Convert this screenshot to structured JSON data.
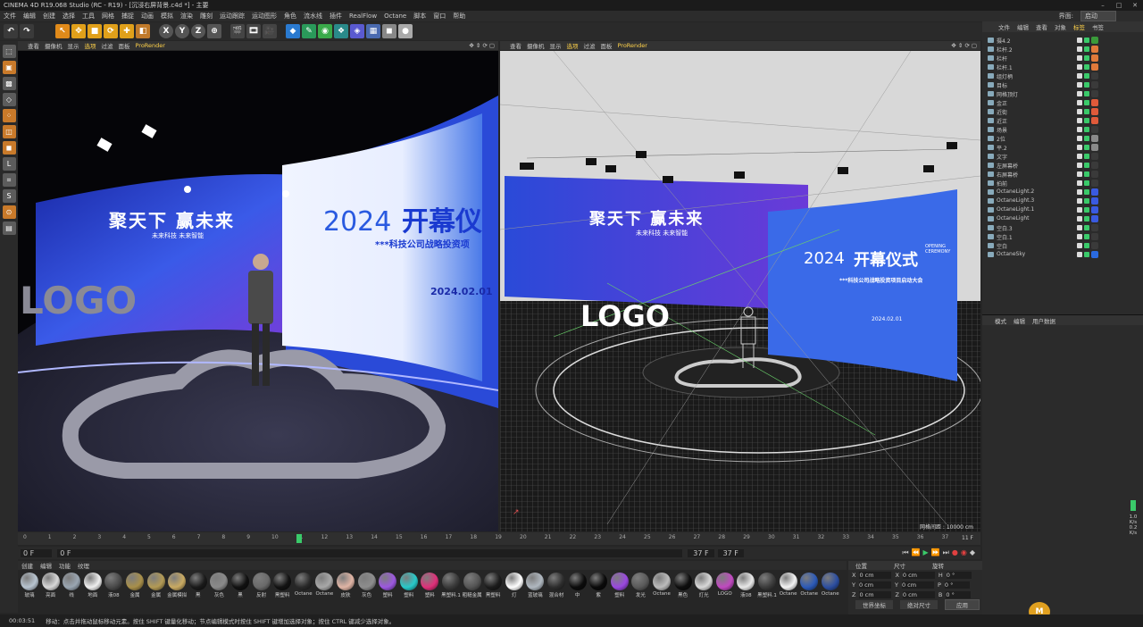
{
  "app": {
    "title": "CINEMA 4D R19.068 Studio (RC - R19) - [沉浸右屏背景.c4d *] - 主要",
    "menus": [
      "文件",
      "编辑",
      "创建",
      "选择",
      "工具",
      "网格",
      "捕捉",
      "动画",
      "模拟",
      "渲染",
      "雕刻",
      "运动跟踪",
      "运动图形",
      "角色",
      "流水线",
      "插件",
      "RealFlow",
      "Octane",
      "脚本",
      "窗口",
      "帮助"
    ],
    "layout_label": "界面:",
    "layout_value": "启动"
  },
  "toolbar": {
    "axis_x": "X",
    "axis_y": "Y",
    "axis_z": "Z"
  },
  "viewport_menu": [
    "查看",
    "摄像机",
    "显示",
    "选项",
    "过滤",
    "面板",
    "ProRender"
  ],
  "viewport_left": {
    "title_line": "聚天下 赢未来",
    "subtitle_line": "未来科技 未来智能",
    "logo": "LOGO",
    "year": "2024",
    "main_title": "开幕仪",
    "company": "***科技公司战略投资项",
    "date": "2024.02.01"
  },
  "viewport_right": {
    "title_line": "聚天下 赢未来",
    "subtitle_line": "未来科技 未来智能",
    "logo": "LOGO",
    "year": "2024",
    "main_title": "开幕仪式",
    "side_text": "OPENING CEREMONY",
    "company": "***科技公司战略投资项目启动大会",
    "date": "2024.02.01",
    "grid_label": "网格间距 : 10000 cm"
  },
  "timeline": {
    "ticks": [
      "0",
      "1",
      "2",
      "3",
      "4",
      "5",
      "6",
      "7",
      "8",
      "9",
      "10",
      "11",
      "12",
      "13",
      "14",
      "15",
      "16",
      "17",
      "18",
      "19",
      "20",
      "21",
      "22",
      "23",
      "24",
      "25",
      "26",
      "27",
      "28",
      "29",
      "30",
      "31",
      "32",
      "33",
      "34",
      "35",
      "36",
      "37"
    ],
    "current_frame": "11",
    "end_frame": "11 F"
  },
  "transport": {
    "start": "0 F",
    "field": "0 F",
    "end": "37 F",
    "end2": "37 F"
  },
  "materials_menu": [
    "创建",
    "编辑",
    "功能",
    "纹理"
  ],
  "materials": [
    {
      "name": "玻璃",
      "color": "#b8c4d0"
    },
    {
      "name": "亮面",
      "color": "#d8d8d8"
    },
    {
      "name": "线",
      "color": "#9aa6b2"
    },
    {
      "name": "地面",
      "color": "#f0f0f0"
    },
    {
      "name": "液08",
      "color": "#4a4a4a"
    },
    {
      "name": "金属",
      "color": "#a88f4a"
    },
    {
      "name": "金属",
      "color": "#b39a55"
    },
    {
      "name": "金属模拟",
      "color": "#c9aa62"
    },
    {
      "name": "黑",
      "color": "#1a1a1a"
    },
    {
      "name": "灰色",
      "color": "#8a8a8a"
    },
    {
      "name": "黑",
      "color": "#111111"
    },
    {
      "name": "反射",
      "color": "#6a6a6a"
    },
    {
      "name": "黑塑料",
      "color": "#121212"
    },
    {
      "name": "Octane",
      "color": "#2a2a2a"
    },
    {
      "name": "Octane",
      "color": "#a8a8a8"
    },
    {
      "name": "皮肤",
      "color": "#e0b5a5"
    },
    {
      "name": "灰色",
      "color": "#8d8d8d"
    },
    {
      "name": "塑料",
      "color": "#9c58e0"
    },
    {
      "name": "塑料",
      "color": "#28c9c9"
    },
    {
      "name": "塑料",
      "color": "#e0307a"
    },
    {
      "name": "黑塑料.1",
      "color": "#3a3a3a"
    },
    {
      "name": "粗糙金属",
      "color": "#555555"
    },
    {
      "name": "黑塑料",
      "color": "#1c1c1c"
    },
    {
      "name": "灯",
      "color": "#ffffff"
    },
    {
      "name": "蓝玻璃",
      "color": "#b0b8c0"
    },
    {
      "name": "混合材",
      "color": "#2e2e2e"
    },
    {
      "name": "中",
      "color": "#0c0c0c"
    },
    {
      "name": "紫",
      "color": "#0a0a0a"
    },
    {
      "name": "塑料",
      "color": "#9a48e0"
    },
    {
      "name": "发光",
      "color": "#5a5a5a"
    },
    {
      "name": "Octane",
      "color": "#bcbcbc"
    },
    {
      "name": "黑色",
      "color": "#0e0e0e"
    },
    {
      "name": "灯光",
      "color": "#d8d8d8"
    },
    {
      "name": "LOGO",
      "color": "#c04ac0"
    },
    {
      "name": "液08",
      "color": "#e8e8e8"
    },
    {
      "name": "黑塑料.1",
      "color": "#3c3c3c"
    },
    {
      "name": "Octane",
      "color": "#f4f4f4"
    },
    {
      "name": "Octane",
      "color": "#2c5ab8"
    },
    {
      "name": "Octane",
      "color": "#2c4ea0"
    }
  ],
  "coords": {
    "header": [
      "位置",
      "尺寸",
      "旋转"
    ],
    "rows": [
      {
        "a": "X",
        "av": "0 cm",
        "b": "X",
        "bv": "0 cm",
        "c": "H",
        "cv": "0 °"
      },
      {
        "a": "Y",
        "av": "0 cm",
        "b": "Y",
        "bv": "0 cm",
        "c": "P",
        "cv": "0 °"
      },
      {
        "a": "Z",
        "av": "0 cm",
        "b": "Z",
        "bv": "0 cm",
        "c": "B",
        "cv": "0 °"
      }
    ],
    "mode": "世界坐标",
    "scale_mode": "绝对尺寸",
    "apply": "应用"
  },
  "object_tabs": [
    "文件",
    "编辑",
    "查看",
    "对象",
    "标签",
    "书签"
  ],
  "objects": [
    {
      "name": "摄4.2",
      "color": "#3a9a3a"
    },
    {
      "name": "栏杆.2",
      "color": "#e07a3a"
    },
    {
      "name": "栏杆",
      "color": "#e07a3a"
    },
    {
      "name": "栏杆.1",
      "color": "#e07a3a"
    },
    {
      "name": "组灯柄",
      "color": "#3a3a3a"
    },
    {
      "name": "目标",
      "color": "#3a3a3a"
    },
    {
      "name": "网格顶灯",
      "color": "#3a3a3a"
    },
    {
      "name": "金正",
      "color": "#e05a3a"
    },
    {
      "name": "近街",
      "color": "#e05a3a"
    },
    {
      "name": "近正",
      "color": "#e05a3a"
    },
    {
      "name": "场景",
      "color": "#3a3a3a"
    },
    {
      "name": "2位",
      "color": "#8a8a8a"
    },
    {
      "name": "平.2",
      "color": "#8a8a8a"
    },
    {
      "name": "文字",
      "color": "#3a3a3a"
    },
    {
      "name": "左屏幕桥",
      "color": "#3a3a3a"
    },
    {
      "name": "右屏幕桥",
      "color": "#3a3a3a"
    },
    {
      "name": "拍前",
      "color": "#3a3a3a"
    },
    {
      "name": "OctaneLight.2",
      "color": "#3a5ae0"
    },
    {
      "name": "OctaneLight.3",
      "color": "#3a5ae0"
    },
    {
      "name": "OctaneLight.1",
      "color": "#3a5ae0"
    },
    {
      "name": "OctaneLight",
      "color": "#3a5ae0"
    },
    {
      "name": "空白.3",
      "color": "#3a3a3a"
    },
    {
      "name": "空白.1",
      "color": "#3a3a3a"
    },
    {
      "name": "空白",
      "color": "#3a3a3a"
    },
    {
      "name": "OctaneSky",
      "color": "#2a6ae0"
    }
  ],
  "attr_tabs": [
    "模式",
    "编辑",
    "用户数据"
  ],
  "status": {
    "time": "00:03:51",
    "message": "移动：点击并拖动鼠标移动元素。按住 SHIFT 键量化移动；节点编辑模式时按住 SHIFT 键增加选择对象；按住 CTRL 键减少选择对象。"
  },
  "render_scale": {
    "v1": "1.0",
    "u1": "K/s",
    "v2": "0.2",
    "u2": "K/s"
  }
}
